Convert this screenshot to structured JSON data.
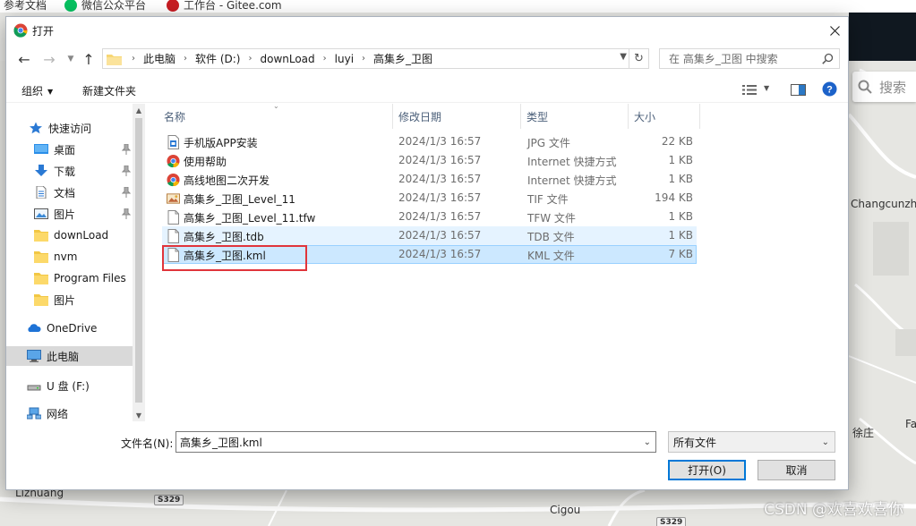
{
  "bookmarks": [
    "参考文档",
    "微信公众平台",
    "工作台 - Gitee.com"
  ],
  "map": {
    "search_placeholder": "搜索",
    "labels": [
      "Changcunzh",
      "Fa",
      "徐庄",
      "Lizhuang",
      "Cigou"
    ],
    "road_shields": [
      "S329",
      "S329"
    ],
    "watermark": "CSDN @欢喜欢喜你"
  },
  "dialog": {
    "title": "打开",
    "app_icon": "chrome-icon",
    "breadcrumb": [
      "此电脑",
      "软件 (D:)",
      "downLoad",
      "luyi",
      "高集乡_卫图"
    ],
    "search_placeholder": "在 高集乡_卫图 中搜索",
    "toolbar": {
      "organize": "组织",
      "new_folder": "新建文件夹"
    },
    "nav": [
      {
        "label": "快速访问",
        "icon": "star-icon"
      },
      {
        "label": "桌面",
        "icon": "desktop-icon",
        "pinned": true
      },
      {
        "label": "下载",
        "icon": "download-icon",
        "pinned": true
      },
      {
        "label": "文档",
        "icon": "document-icon",
        "pinned": true
      },
      {
        "label": "图片",
        "icon": "pictures-icon",
        "pinned": true
      },
      {
        "label": "downLoad",
        "icon": "folder-icon"
      },
      {
        "label": "nvm",
        "icon": "folder-icon"
      },
      {
        "label": "Program Files",
        "icon": "folder-icon"
      },
      {
        "label": "图片",
        "icon": "folder-icon"
      },
      {
        "label": "OneDrive",
        "icon": "cloud-icon"
      },
      {
        "label": "此电脑",
        "icon": "computer-icon",
        "selected": true
      },
      {
        "label": "U 盘 (F:)",
        "icon": "usb-drive-icon"
      },
      {
        "label": "网络",
        "icon": "network-icon"
      }
    ],
    "columns": [
      "名称",
      "修改日期",
      "类型",
      "大小"
    ],
    "files": [
      {
        "name": "手机版APP安装",
        "date": "2024/1/3 16:57",
        "type": "JPG 文件",
        "size": "22 KB",
        "icon": "image-file-icon"
      },
      {
        "name": "使用帮助",
        "date": "2024/1/3 16:57",
        "type": "Internet 快捷方式",
        "size": "1 KB",
        "icon": "chrome-shortcut-icon"
      },
      {
        "name": "高线地图二次开发",
        "date": "2024/1/3 16:57",
        "type": "Internet 快捷方式",
        "size": "1 KB",
        "icon": "chrome-shortcut-icon"
      },
      {
        "name": "高集乡_卫图_Level_11",
        "date": "2024/1/3 16:57",
        "type": "TIF 文件",
        "size": "194 KB",
        "icon": "tif-file-icon"
      },
      {
        "name": "高集乡_卫图_Level_11.tfw",
        "date": "2024/1/3 16:57",
        "type": "TFW 文件",
        "size": "1 KB",
        "icon": "blank-file-icon"
      },
      {
        "name": "高集乡_卫图.tdb",
        "date": "2024/1/3 16:57",
        "type": "TDB 文件",
        "size": "1 KB",
        "icon": "blank-file-icon",
        "state": "hover"
      },
      {
        "name": "高集乡_卫图.kml",
        "date": "2024/1/3 16:57",
        "type": "KML 文件",
        "size": "7 KB",
        "icon": "blank-file-icon",
        "state": "selected"
      }
    ],
    "filename_label": "文件名(N):",
    "filename_value": "高集乡_卫图.kml",
    "filetype_value": "所有文件",
    "open_button": "打开(O)",
    "cancel_button": "取消"
  }
}
